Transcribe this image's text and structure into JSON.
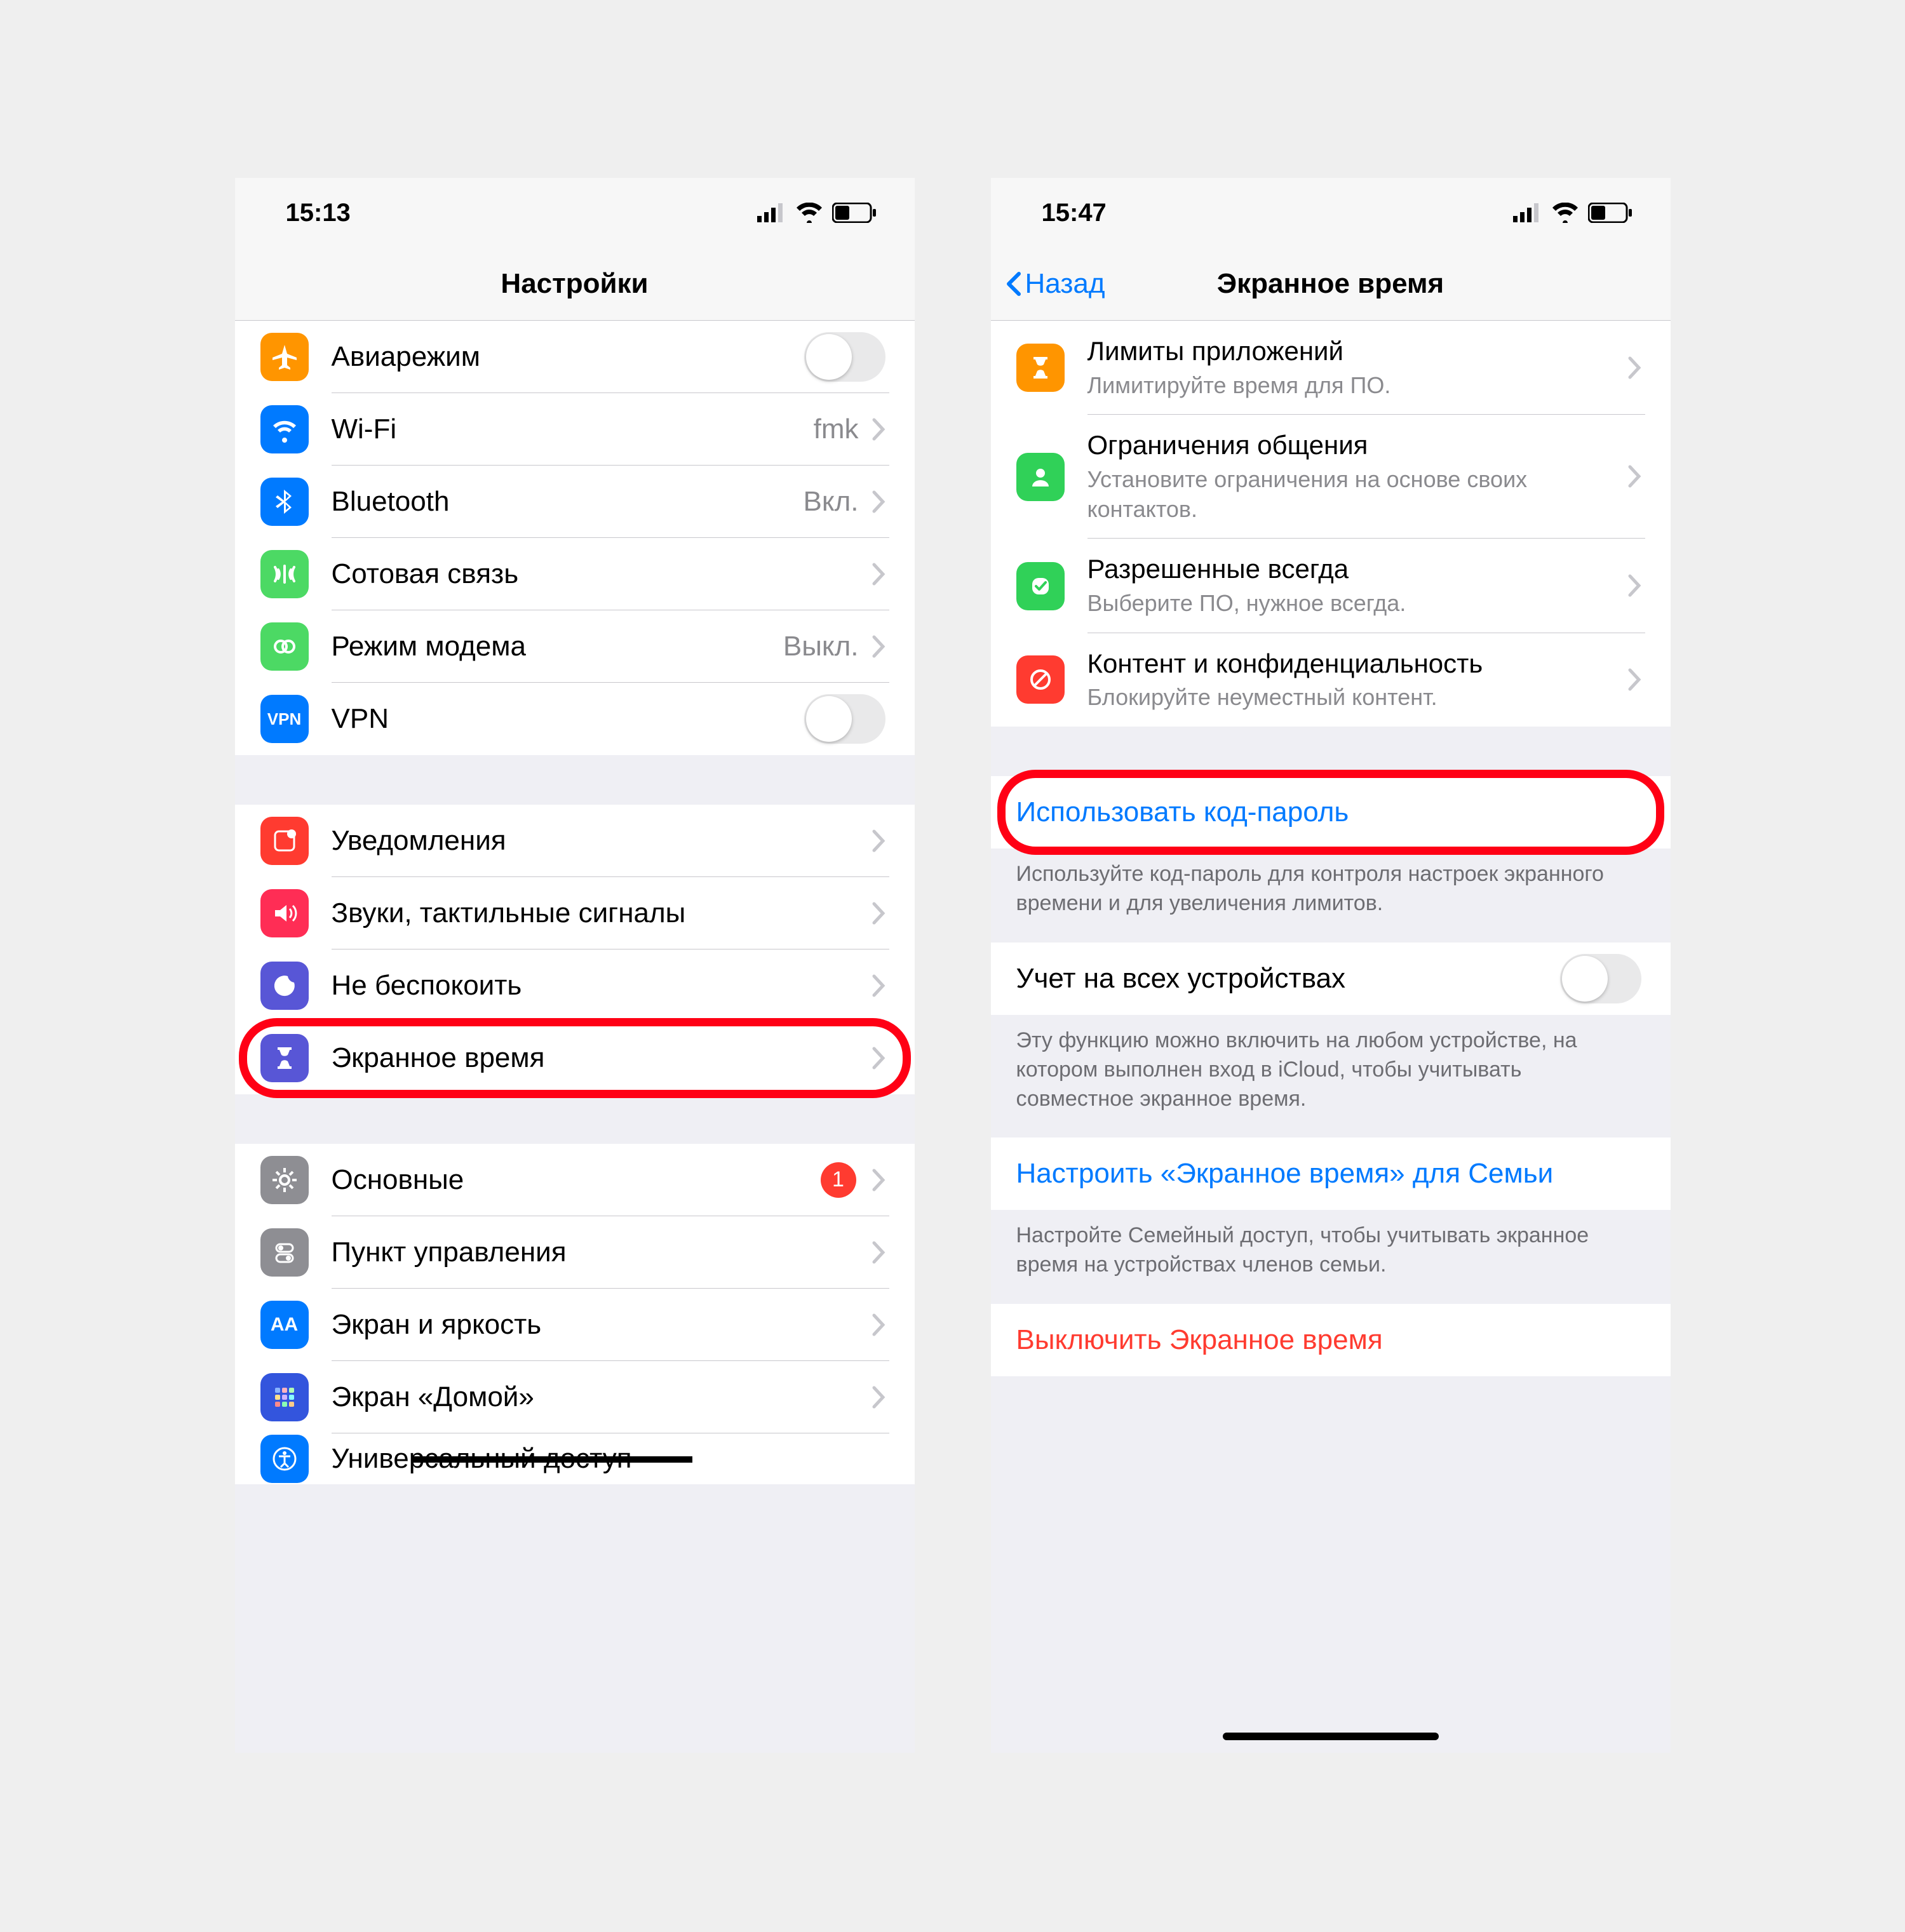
{
  "left": {
    "status_time": "15:13",
    "title": "Настройки",
    "g1": [
      {
        "icon": "airplane",
        "color": "#ff9500",
        "label": "Авиарежим",
        "type": "toggle"
      },
      {
        "icon": "wifi",
        "color": "#007aff",
        "label": "Wi-Fi",
        "value": "fmk",
        "type": "nav"
      },
      {
        "icon": "bluetooth",
        "color": "#007aff",
        "label": "Bluetooth",
        "value": "Вкл.",
        "type": "nav"
      },
      {
        "icon": "cellular",
        "color": "#4cd964",
        "label": "Сотовая связь",
        "type": "nav"
      },
      {
        "icon": "hotspot",
        "color": "#4cd964",
        "label": "Режим модема",
        "value": "Выкл.",
        "type": "nav"
      },
      {
        "icon": "vpn",
        "color": "#007aff",
        "label": "VPN",
        "type": "toggle"
      }
    ],
    "g2": [
      {
        "icon": "notifications",
        "color": "#ff3b30",
        "label": "Уведомления",
        "type": "nav"
      },
      {
        "icon": "sounds",
        "color": "#ff2d55",
        "label": "Звуки, тактильные сигналы",
        "type": "nav"
      },
      {
        "icon": "dnd",
        "color": "#5856d6",
        "label": "Не беспокоить",
        "type": "nav"
      },
      {
        "icon": "screentime",
        "color": "#5856d6",
        "label": "Экранное время",
        "type": "nav",
        "circled": true
      }
    ],
    "g3": [
      {
        "icon": "general",
        "color": "#8e8e93",
        "label": "Основные",
        "type": "nav",
        "badge": "1"
      },
      {
        "icon": "control",
        "color": "#8e8e93",
        "label": "Пункт управления",
        "type": "nav"
      },
      {
        "icon": "display",
        "color": "#007aff",
        "label": "Экран и яркость",
        "type": "nav"
      },
      {
        "icon": "home",
        "color": "#3355dd",
        "label": "Экран «Домой»",
        "type": "nav"
      },
      {
        "icon": "accessibility",
        "color": "#007aff",
        "label": "Универсальный доступ",
        "type": "nav"
      }
    ]
  },
  "right": {
    "status_time": "15:47",
    "back": "Назад",
    "title": "Экранное время",
    "g1": [
      {
        "icon": "hourglass",
        "color": "#ff9500",
        "t": "Лимиты приложений",
        "s": "Лимитируйте время для ПО."
      },
      {
        "icon": "contact",
        "color": "#30d158",
        "t": "Ограничения общения",
        "s": "Установите ограничения на основе своих контактов."
      },
      {
        "icon": "check",
        "color": "#30d158",
        "t": "Разрешенные всегда",
        "s": "Выберите ПО, нужное всегда."
      },
      {
        "icon": "block",
        "color": "#ff3b30",
        "t": "Контент и конфиденциальность",
        "s": "Блокируйте неуместный контент."
      }
    ],
    "passcode_label": "Использовать код-пароль",
    "passcode_footer": "Используйте код-пароль для контроля настроек экранного времени и для увеличения лимитов.",
    "share_label": "Учет на всех устройствах",
    "share_footer": "Эту функцию можно включить на любом устройстве, на котором выполнен вход в iCloud, чтобы учитывать совместное экранное время.",
    "family_label": "Настроить «Экранное время» для Семьи",
    "family_footer": "Настройте Семейный доступ, чтобы учитывать экранное время на устройствах членов семьи.",
    "off_label": "Выключить Экранное время"
  }
}
